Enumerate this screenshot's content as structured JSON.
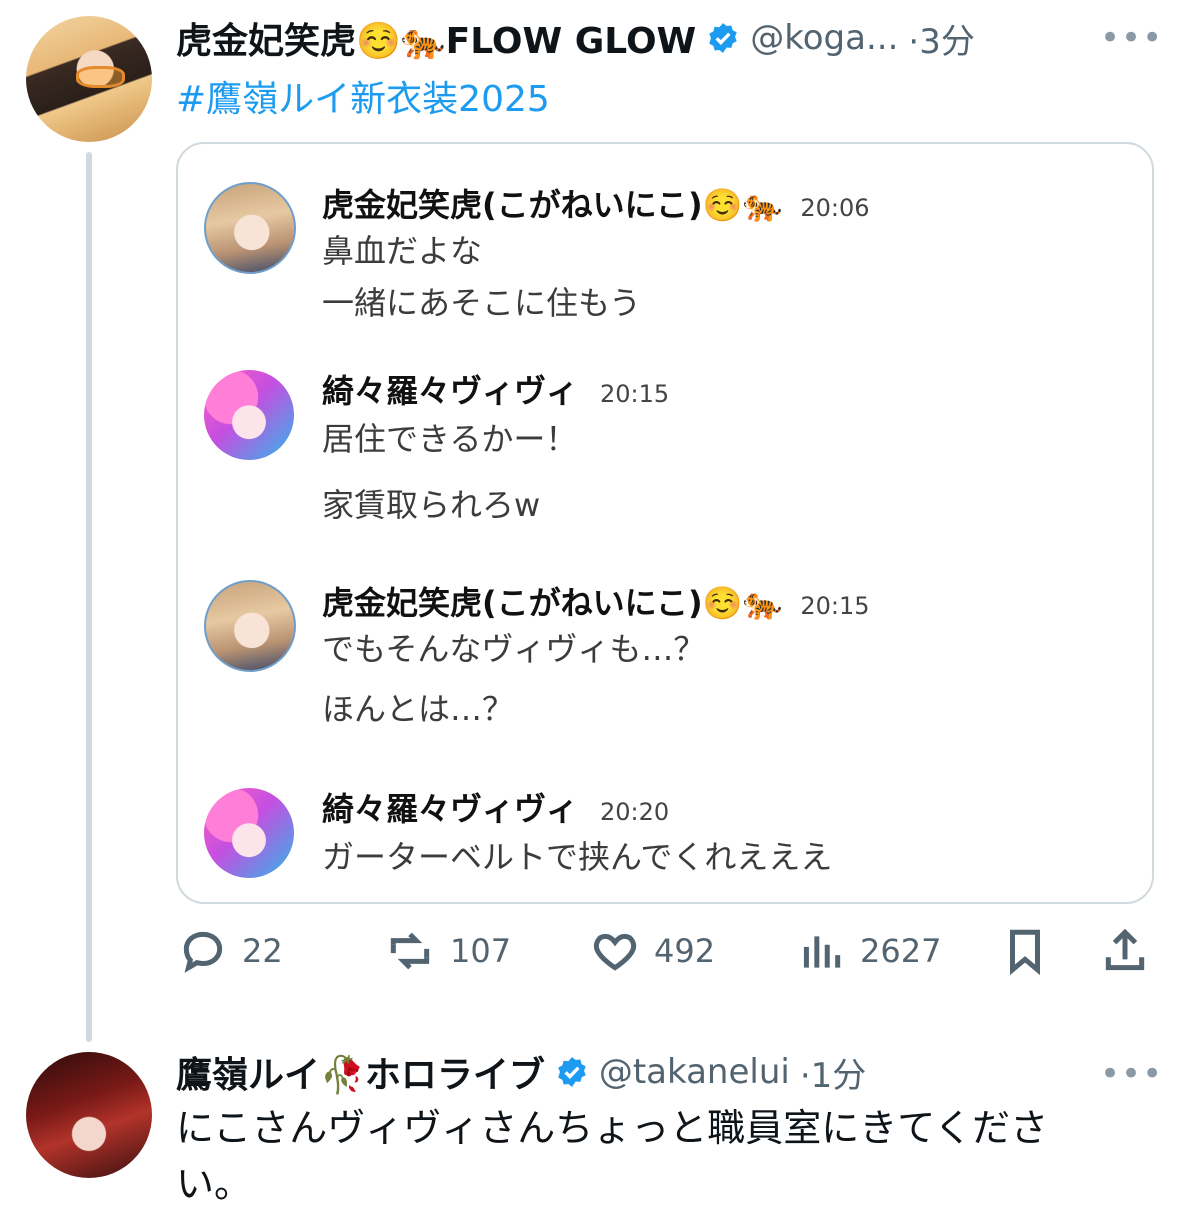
{
  "tweet": {
    "author_name": "虎金妃笑虎☺️🐅FLOW GLOW",
    "author_handle": "@koga...",
    "time": "·3分",
    "hashtag": "#鷹嶺ルイ新衣装2025",
    "more": "•••",
    "quote_messages": [
      {
        "sender": "虎金妃笑虎(こがねいにこ)☺️🐅",
        "time": "20:06",
        "lines": [
          "鼻血だよな",
          "一緒にあそこに住もう"
        ],
        "avatar": "tiger"
      },
      {
        "sender": "綺々羅々ヴィヴィ",
        "time": "20:15",
        "lines": [
          "居住できるかー！",
          "家賃取られろw"
        ],
        "avatar": "vivi"
      },
      {
        "sender": "虎金妃笑虎(こがねいにこ)☺️🐅",
        "time": "20:15",
        "lines": [
          "でもそんなヴィヴィも…？",
          "ほんとは…？"
        ],
        "avatar": "tiger"
      },
      {
        "sender": "綺々羅々ヴィヴィ",
        "time": "20:20",
        "lines": [
          "ガーターベルトで挟んでくれえええ"
        ],
        "avatar": "vivi"
      }
    ],
    "actions": {
      "reply_count": "22",
      "retweet_count": "107",
      "like_count": "492",
      "view_count": "2627"
    }
  },
  "reply": {
    "author_name": "鷹嶺ルイ🥀ホロライブ",
    "author_handle": "@takanelui",
    "time": "·1分",
    "more": "•••",
    "text": "にこさんヴィヴィさんちょっと職員室にきてください。"
  },
  "colors": {
    "accent": "#1d9bf0",
    "secondary_text": "#536471",
    "border": "#cfd9de"
  },
  "icons": [
    "verified-badge-icon",
    "reply-icon",
    "retweet-icon",
    "like-icon",
    "views-icon",
    "bookmark-icon",
    "share-icon",
    "more-icon"
  ]
}
